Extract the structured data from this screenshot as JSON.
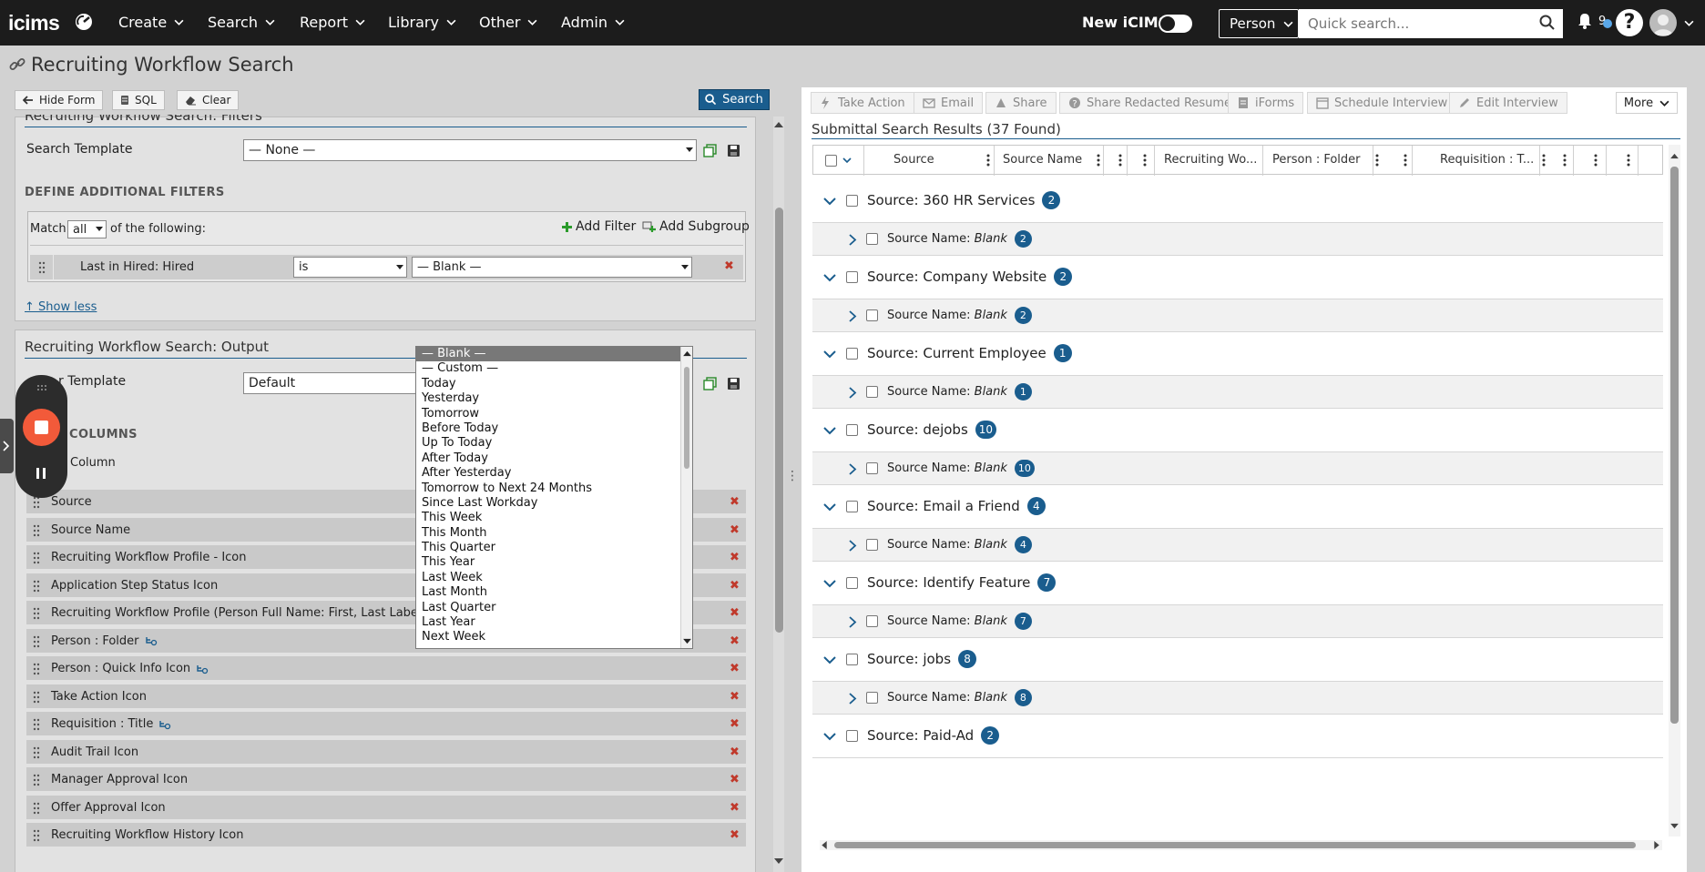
{
  "nav": {
    "logo": "icims",
    "items": [
      {
        "label": "Create"
      },
      {
        "label": "Search"
      },
      {
        "label": "Report"
      },
      {
        "label": "Library"
      },
      {
        "label": "Other"
      },
      {
        "label": "Admin"
      }
    ],
    "new_icims": "New iCIMS",
    "person_select": "Person",
    "quick_search_placeholder": "Quick search...",
    "notification_count": "9",
    "help": "?"
  },
  "left": {
    "page_title": "Recruiting Workflow Search",
    "toolbar": {
      "hide_form": "Hide Form",
      "sql": "SQL",
      "clear": "Clear",
      "search": "Search"
    },
    "filters": {
      "title": "Recruiting Workflow Search: Filters",
      "search_template_label": "Search Template",
      "search_template_value": "— None —",
      "define_filters": "DEFINE ADDITIONAL FILTERS",
      "match_prefix": "Match",
      "match_value": "all",
      "match_suffix": "of the following:",
      "add_filter": "Add Filter",
      "add_subgroup": "Add Subgroup",
      "row": {
        "field": "Last in Hired: Hired",
        "operator": "is",
        "value": "— Blank —"
      },
      "show_less": "↑ Show less"
    },
    "output": {
      "title": "Recruiting Workflow Search: Output",
      "template_label": "r Template",
      "template_value": "Default",
      "columns_caps": "COLUMNS",
      "add_column": "Column",
      "columns": [
        {
          "label": "Source",
          "has_icon": false
        },
        {
          "label": "Source Name",
          "has_icon": false
        },
        {
          "label": "Recruiting Workflow Profile - Icon",
          "has_icon": false
        },
        {
          "label": "Application Step Status Icon",
          "has_icon": false
        },
        {
          "label": "Recruiting Workflow Profile (Person Full Name: First, Last Label)",
          "has_icon": false
        },
        {
          "label": "Person : Folder",
          "has_icon": true
        },
        {
          "label": "Person : Quick Info Icon",
          "has_icon": true
        },
        {
          "label": "Take Action Icon",
          "has_icon": false
        },
        {
          "label": "Requisition : Title",
          "has_icon": true
        },
        {
          "label": "Audit Trail Icon",
          "has_icon": false
        },
        {
          "label": "Manager Approval Icon",
          "has_icon": false
        },
        {
          "label": "Offer Approval Icon",
          "has_icon": false
        },
        {
          "label": "Recruiting Workflow History Icon",
          "has_icon": false
        }
      ]
    },
    "dropdown_options": [
      "— Blank —",
      "— Custom —",
      "Today",
      "Yesterday",
      "Tomorrow",
      "Before Today",
      "Up To Today",
      "After Today",
      "After Yesterday",
      "Tomorrow to Next 24 Months",
      "Since Last Workday",
      "This Week",
      "This Month",
      "This Quarter",
      "This Year",
      "Last Week",
      "Last Month",
      "Last Quarter",
      "Last Year",
      "Next Week"
    ]
  },
  "right": {
    "actions": [
      "Take Action",
      "Email",
      "Share",
      "Share Redacted Resume",
      "iForms",
      "Schedule Interview",
      "Edit Interview"
    ],
    "more": "More",
    "results_title": "Submittal Search Results (37 Found)",
    "headers": {
      "source": "Source",
      "source_name": "Source Name",
      "recruiting_workflow": "Recruiting Wo...",
      "person_folder": "Person : Folder",
      "requisition": "Requisition : T..."
    },
    "groups": [
      {
        "label": "Source: 360 HR Services",
        "count": "2",
        "sub_label": "Source Name:",
        "sub_value": "Blank",
        "sub_count": "2"
      },
      {
        "label": "Source: Company Website",
        "count": "2",
        "sub_label": "Source Name:",
        "sub_value": "Blank",
        "sub_count": "2"
      },
      {
        "label": "Source: Current Employee",
        "count": "1",
        "sub_label": "Source Name:",
        "sub_value": "Blank",
        "sub_count": "1"
      },
      {
        "label": "Source: dejobs",
        "count": "10",
        "sub_label": "Source Name:",
        "sub_value": "Blank",
        "sub_count": "10"
      },
      {
        "label": "Source: Email a Friend",
        "count": "4",
        "sub_label": "Source Name:",
        "sub_value": "Blank",
        "sub_count": "4"
      },
      {
        "label": "Source: Identify Feature",
        "count": "7",
        "sub_label": "Source Name:",
        "sub_value": "Blank",
        "sub_count": "7"
      },
      {
        "label": "Source: jobs",
        "count": "8",
        "sub_label": "Source Name:",
        "sub_value": "Blank",
        "sub_count": "8"
      },
      {
        "label": "Source: Paid-Ad",
        "count": "2"
      }
    ]
  }
}
